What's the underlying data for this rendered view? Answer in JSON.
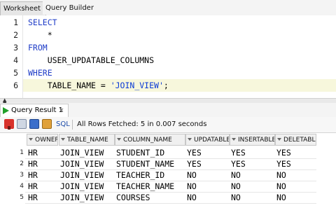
{
  "tabs": {
    "worksheet": "Worksheet",
    "query_builder": "Query Builder"
  },
  "editor": {
    "line_numbers": [
      "1",
      "2",
      "3",
      "4",
      "5",
      "6"
    ],
    "lines": [
      {
        "segments": [
          {
            "type": "kw",
            "text": "SELECT"
          }
        ]
      },
      {
        "segments": [
          {
            "type": "plain",
            "text": "    *"
          }
        ]
      },
      {
        "segments": [
          {
            "type": "kw",
            "text": "FROM"
          }
        ]
      },
      {
        "segments": [
          {
            "type": "plain",
            "text": "    USER_UPDATABLE_COLUMNS"
          }
        ]
      },
      {
        "segments": [
          {
            "type": "kw",
            "text": "WHERE"
          }
        ]
      },
      {
        "segments": [
          {
            "type": "plain",
            "text": "    TABLE_NAME = "
          },
          {
            "type": "str",
            "text": "'JOIN_VIEW'"
          },
          {
            "type": "plain",
            "text": ";"
          }
        ]
      }
    ]
  },
  "result": {
    "tab_label": "Query Result 1",
    "close_symbol": "×",
    "toolbar": {
      "icons": [
        "pin-icon",
        "print-icon",
        "save-icon",
        "export-icon"
      ],
      "sql_label": "SQL",
      "fetch_status": "All Rows Fetched: 5 in 0.007 seconds"
    },
    "columns": [
      "OWNER",
      "TABLE_NAME",
      "COLUMN_NAME",
      "UPDATABLE",
      "INSERTABLE",
      "DELETABLE"
    ],
    "rows": [
      {
        "num": "1",
        "cells": [
          "HR",
          "JOIN_VIEW",
          "STUDENT_ID",
          "YES",
          "YES",
          "YES"
        ]
      },
      {
        "num": "2",
        "cells": [
          "HR",
          "JOIN_VIEW",
          "STUDENT_NAME",
          "YES",
          "YES",
          "YES"
        ]
      },
      {
        "num": "3",
        "cells": [
          "HR",
          "JOIN_VIEW",
          "TEACHER_ID",
          "NO",
          "NO",
          "NO"
        ]
      },
      {
        "num": "4",
        "cells": [
          "HR",
          "JOIN_VIEW",
          "TEACHER_NAME",
          "NO",
          "NO",
          "NO"
        ]
      },
      {
        "num": "5",
        "cells": [
          "HR",
          "JOIN_VIEW",
          "COURSES",
          "NO",
          "NO",
          "NO"
        ]
      }
    ]
  },
  "colors": {
    "keyword": "#1f3cc7",
    "string": "#0a3ad6",
    "run_icon": "#21a02b",
    "pin_icon": "#d8322b"
  }
}
